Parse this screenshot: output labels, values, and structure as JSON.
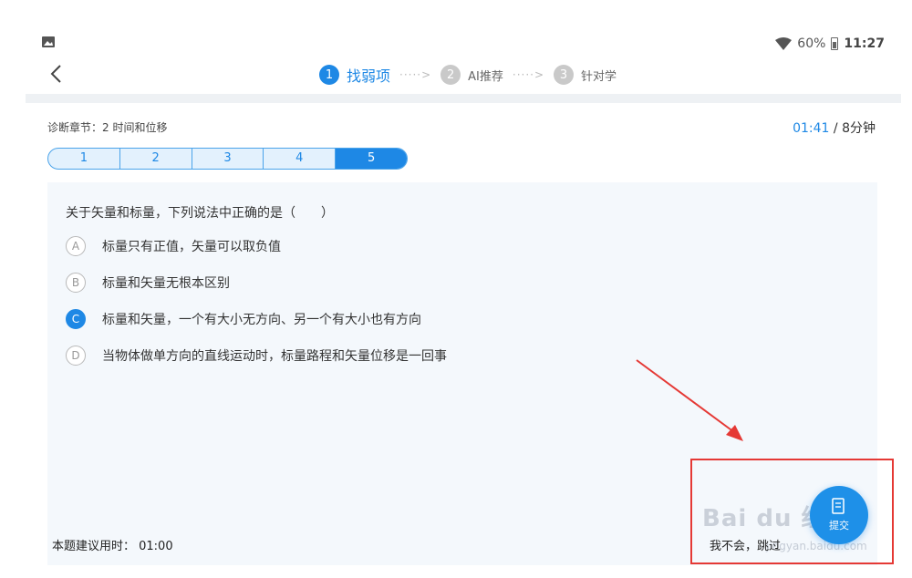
{
  "status_bar": {
    "battery": "60%",
    "time": "11:27"
  },
  "steps": [
    {
      "num": "1",
      "label": "找弱项"
    },
    {
      "num": "2",
      "label": "AI推荐"
    },
    {
      "num": "3",
      "label": "针对学"
    }
  ],
  "chapter": "诊断章节：2 时间和位移",
  "timer": {
    "elapsed": "01:41",
    "total": " / 8分钟"
  },
  "question_tabs": [
    "1",
    "2",
    "3",
    "4",
    "5"
  ],
  "current_tab": "5",
  "question": "关于矢量和标量，下列说法中正确的是（　　）",
  "options": [
    {
      "letter": "A",
      "text": "标量只有正值，矢量可以取负值"
    },
    {
      "letter": "B",
      "text": "标量和矢量无根本区别"
    },
    {
      "letter": "C",
      "text": "标量和矢量，一个有大小无方向、另一个有大小也有方向"
    },
    {
      "letter": "D",
      "text": "当物体做单方向的直线运动时，标量路程和矢量位移是一回事"
    }
  ],
  "selected_option": "C",
  "suggested_time": "本题建议用时：  01:00",
  "skip_label": "我不会，跳过",
  "submit_label": "提交",
  "watermark": {
    "logo": "Bai du 经验",
    "url": "jingyan.baidu.com"
  },
  "colors": {
    "accent": "#1e88e5",
    "annotation": "#e53935",
    "panel_bg": "#f4f8fc"
  }
}
